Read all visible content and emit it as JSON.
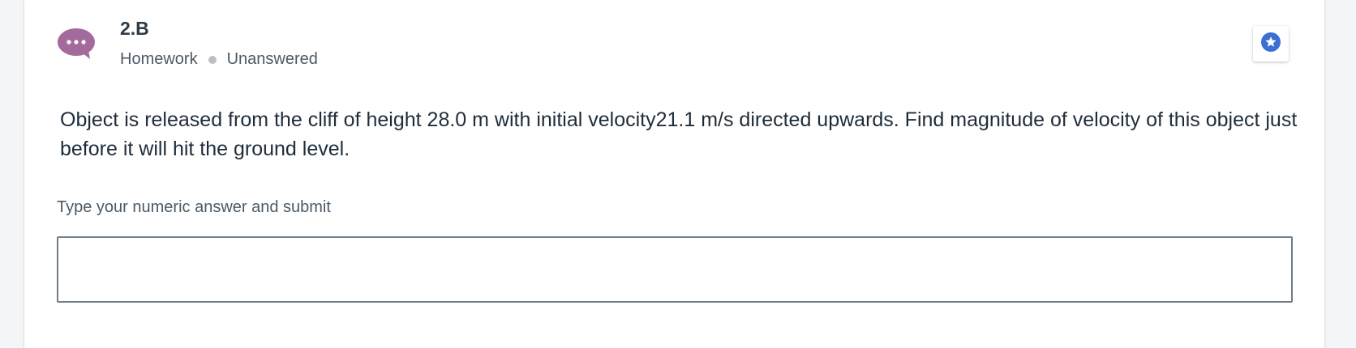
{
  "question": {
    "number": "2.B",
    "category": "Homework",
    "status": "Unanswered",
    "text": "Object is released from the cliff of height 28.0 m with initial velocity21.1 m/s directed upwards. Find magnitude of velocity of this object just before it will hit the ground level."
  },
  "answer": {
    "label": "Type your numeric answer and submit",
    "value": "",
    "placeholder": ""
  },
  "icons": {
    "chat": "chat-bubble-ellipsis-icon",
    "bookmark": "star-badge-icon"
  },
  "colors": {
    "chat_icon": "#a56a9c",
    "star_badge": "#3b6fd4",
    "text": "#1f2d3a",
    "muted": "#4c5a66",
    "input_border": "#6f7e8a"
  }
}
